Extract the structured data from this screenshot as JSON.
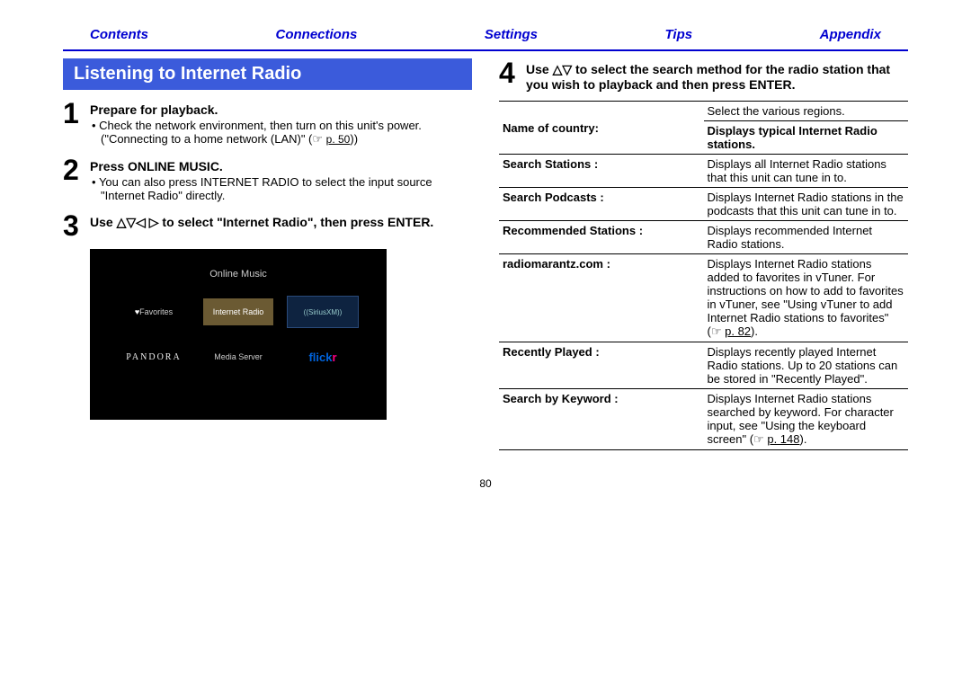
{
  "nav": {
    "contents": "Contents",
    "connections": "Connections",
    "settings": "Settings",
    "tips": "Tips",
    "appendix": "Appendix"
  },
  "heading": "Listening to Internet Radio",
  "step1": {
    "num": "1",
    "title": "Prepare for playback.",
    "bullet": "Check the network environment, then turn on this unit's power. (\"Connecting to a home network (LAN)\" (☞ ",
    "link": "p. 50",
    "bullet_tail": "))"
  },
  "step2": {
    "num": "2",
    "title": "Press ONLINE MUSIC.",
    "bullet": "You can also press INTERNET RADIO to select the input source \"Internet Radio\" directly."
  },
  "step3": {
    "num": "3",
    "title_pre": "Use ",
    "title_arrows": "△▽◁ ▷",
    "title_post": " to select \"Internet Radio\", then press ENTER."
  },
  "screen": {
    "title": "Online Music",
    "favorites": "Favorites",
    "internet_radio": "Internet Radio",
    "sirius": "((SiriusXM))",
    "pandora": "PANDORA",
    "media_server": "Media Server",
    "flickr1": "flick",
    "flickr2": "r"
  },
  "step4": {
    "num": "4",
    "title_pre": "Use ",
    "title_arrows": "△▽",
    "title_post": " to select the search method for the radio station that you wish to playback and then press ENTER."
  },
  "table": {
    "r1l": "Name of country:",
    "r1d": "Select the various regions.",
    "r1d2": "Displays typical Internet Radio stations.",
    "r2l": "Search Stations :",
    "r2d": "Displays all Internet Radio stations that this unit can tune in to.",
    "r3l": "Search Podcasts :",
    "r3d": "Displays Internet Radio stations in the podcasts that this unit can tune in to.",
    "r4l": "Recommended Stations :",
    "r4d": "Displays recommended Internet Radio stations.",
    "r5l": "radiomarantz.com :",
    "r5d_pre": "Displays Internet Radio stations added to favorites in vTuner. For instructions on how to add to favorites in vTuner, see \"Using vTuner to add Internet Radio stations to favorites\" (☞ ",
    "r5d_link": "p. 82",
    "r5d_post": ").",
    "r6l": "Recently Played :",
    "r6d": "Displays recently played Internet Radio stations. Up to 20 stations can be stored in \"Recently Played\".",
    "r7l": "Search by Keyword :",
    "r7d_pre": "Displays Internet Radio stations searched by keyword. For character input, see \"Using the keyboard screen\" (☞ ",
    "r7d_link": "p. 148",
    "r7d_post": ")."
  },
  "page_number": "80"
}
